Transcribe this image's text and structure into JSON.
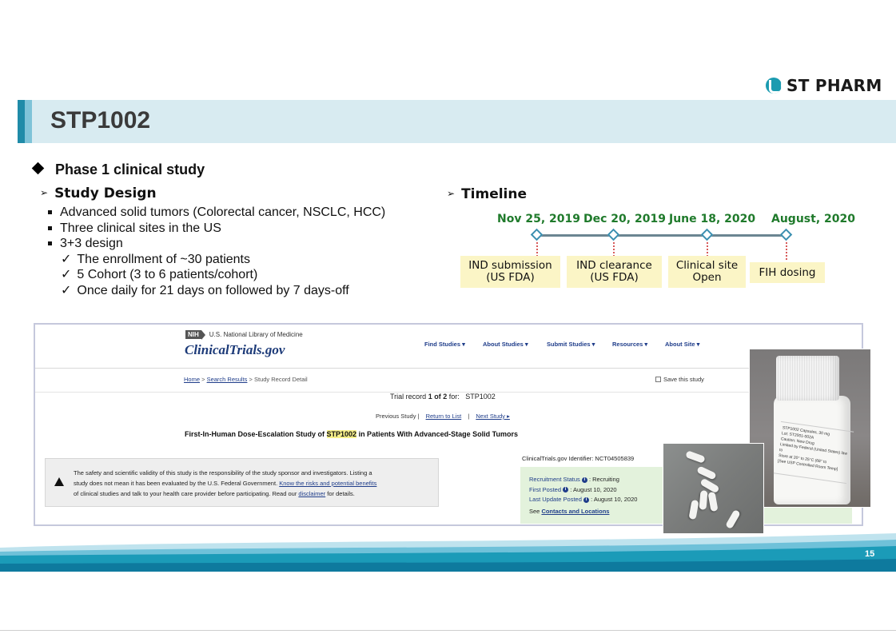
{
  "logo": {
    "text": "ST PHARM"
  },
  "slide": {
    "title": "STP1002",
    "page_number": "15"
  },
  "phase": {
    "heading": "Phase 1 clinical study"
  },
  "study_design": {
    "heading": "Study Design",
    "bullets": [
      "Advanced solid tumors (Colorectal cancer, NSCLC, HCC)",
      "Three clinical sites in the US",
      "3+3 design"
    ],
    "checks": [
      "The enrollment of ~30 patients",
      "5 Cohort (3 to 6 patients/cohort)",
      "Once daily for 21 days on followed by 7 days-off"
    ]
  },
  "timeline": {
    "heading": "Timeline",
    "events": [
      {
        "date": "Nov 25, 2019",
        "line1": "IND submission",
        "line2": "(US FDA)"
      },
      {
        "date": "Dec 20, 2019",
        "line1": "IND clearance",
        "line2": "(US FDA)"
      },
      {
        "date": "June 18, 2020",
        "line1": "Clinical site",
        "line2": "Open"
      },
      {
        "date": "August, 2020",
        "line1": "FIH dosing",
        "line2": ""
      }
    ]
  },
  "clinicaltrials": {
    "nih_badge": "NIH",
    "nih_text": "U.S. National Library of Medicine",
    "logo": "ClinicalTrials.gov",
    "nav": [
      "Find Studies ▾",
      "About Studies ▾",
      "Submit Studies ▾",
      "Resources ▾",
      "About Site ▾"
    ],
    "breadcrumb": {
      "home": "Home",
      "sep": " > ",
      "results": "Search Results",
      "current": "Study Record Detail"
    },
    "save_label": "Save this study",
    "trial_record": {
      "prefix": "Trial record ",
      "bold": "1 of 2",
      "mid": " for:   ",
      "term": "STP1002"
    },
    "prevnext": {
      "prev": "Previous Study |",
      "return": "Return to List",
      "sep": "|",
      "next": "Next Study ▸"
    },
    "study_title": {
      "pre": "First-In-Human Dose-Escalation Study of ",
      "hl": "STP1002",
      "post": " in Patients With Advanced-Stage Solid Tumors"
    },
    "warning": {
      "line1": "The safety and scientific validity of this study is the responsibility of the study sponsor and investigators. Listing a",
      "line2_pre": "study does not mean it has been evaluated by the U.S. Federal Government. ",
      "line2_link": "Know the risks and potential benefits",
      "line3_pre": "of clinical studies and talk to your health care provider before participating. Read our ",
      "line3_link": "disclaimer",
      "line3_post": " for details."
    },
    "identifier": "ClinicalTrials.gov Identifier: NCT04505839",
    "status": {
      "recruitment_key": "Recruitment Status",
      "recruitment_val": " : Recruiting",
      "first_posted_key": "First Posted",
      "first_posted_val": " : August 10, 2020",
      "last_update_key": "Last Update Posted",
      "last_update_val": " : August 10, 2020",
      "see": "See ",
      "contacts_link": "Contacts and Locations"
    }
  },
  "bottle_label": {
    "line1": "STP1002 Capsules, 30 mg",
    "line2": "Lot: ST2001-002A",
    "line3": "Caution: New Drug",
    "line4": "Limited by Federal (United States) law to",
    "line5": "Store at 20° to 25°C (68° to",
    "line6": "[See USP Controlled Room Temp]"
  },
  "colors": {
    "accent_dark": "#1f8ba8",
    "accent_light": "#7fc3d8",
    "title_band": "#d8ebf1",
    "date_green": "#1f7a2b",
    "box_yellow": "#fbf5c6"
  }
}
